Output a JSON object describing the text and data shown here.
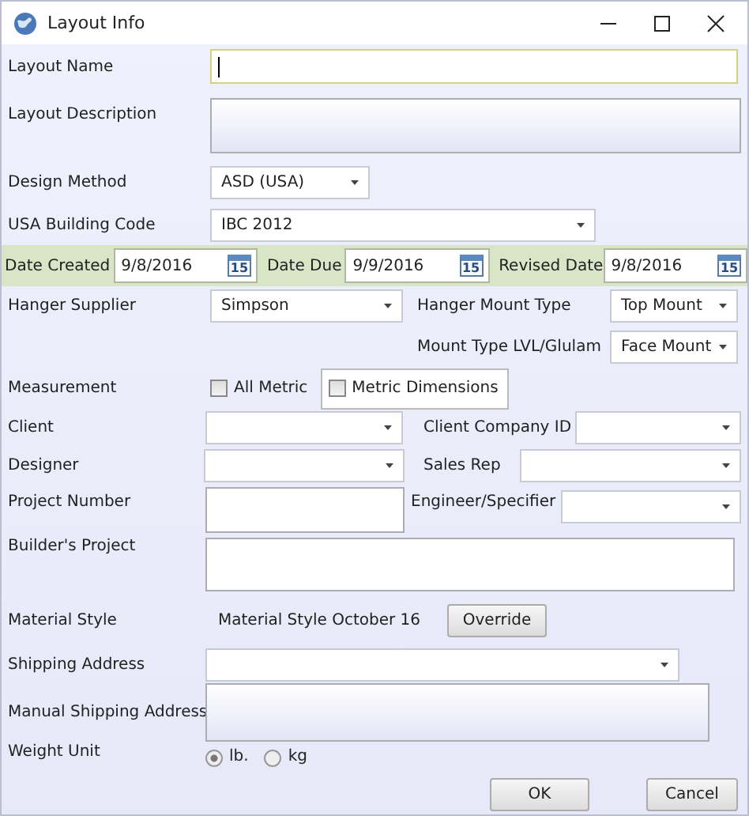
{
  "window": {
    "title": "Layout Info"
  },
  "layout_name": {
    "label": "Layout Name",
    "focused": true
  },
  "layout_description": {
    "label": "Layout Description"
  },
  "design_method": {
    "label": "Design Method",
    "value": "ASD (USA)"
  },
  "building_code": {
    "label": "USA Building Code",
    "value": "IBC 2012"
  },
  "dates": [
    {
      "label": "Date Created",
      "value": "9/8/2016",
      "icon_day": "15"
    },
    {
      "label": "Date Due",
      "value": "9/9/2016",
      "icon_day": "15"
    },
    {
      "label": "Revised Date",
      "value": "9/8/2016",
      "icon_day": "15"
    }
  ],
  "hanger_supplier": {
    "label": "Hanger Supplier",
    "value": "Simpson"
  },
  "hanger_mount_type": {
    "label": "Hanger Mount Type",
    "value": "Top Mount"
  },
  "mount_type_lvl": {
    "label": "Mount Type LVL/Glulam",
    "value": "Face Mount"
  },
  "measurement": {
    "label": "Measurement",
    "options": [
      {
        "label": "All Metric",
        "checked": false
      },
      {
        "label": "Metric Dimensions",
        "checked": false
      }
    ]
  },
  "client": {
    "label": "Client"
  },
  "client_company_id": {
    "label": "Client Company ID"
  },
  "designer": {
    "label": "Designer"
  },
  "sales_rep": {
    "label": "Sales Rep"
  },
  "project_number": {
    "label": "Project Number"
  },
  "engineer": {
    "label": "Engineer/Specifier"
  },
  "builders_project": {
    "label": "Builder's Project"
  },
  "material_style": {
    "label": "Material Style",
    "value": "Material Style October 16",
    "button": "Override"
  },
  "shipping_address": {
    "label": "Shipping Address"
  },
  "manual_shipping_address": {
    "label": "Manual Shipping Address"
  },
  "weight_unit": {
    "label": "Weight Unit",
    "options": [
      {
        "label": "lb.",
        "selected": true
      },
      {
        "label": "kg",
        "selected": false
      }
    ]
  },
  "buttons": [
    "OK",
    "Cancel"
  ]
}
